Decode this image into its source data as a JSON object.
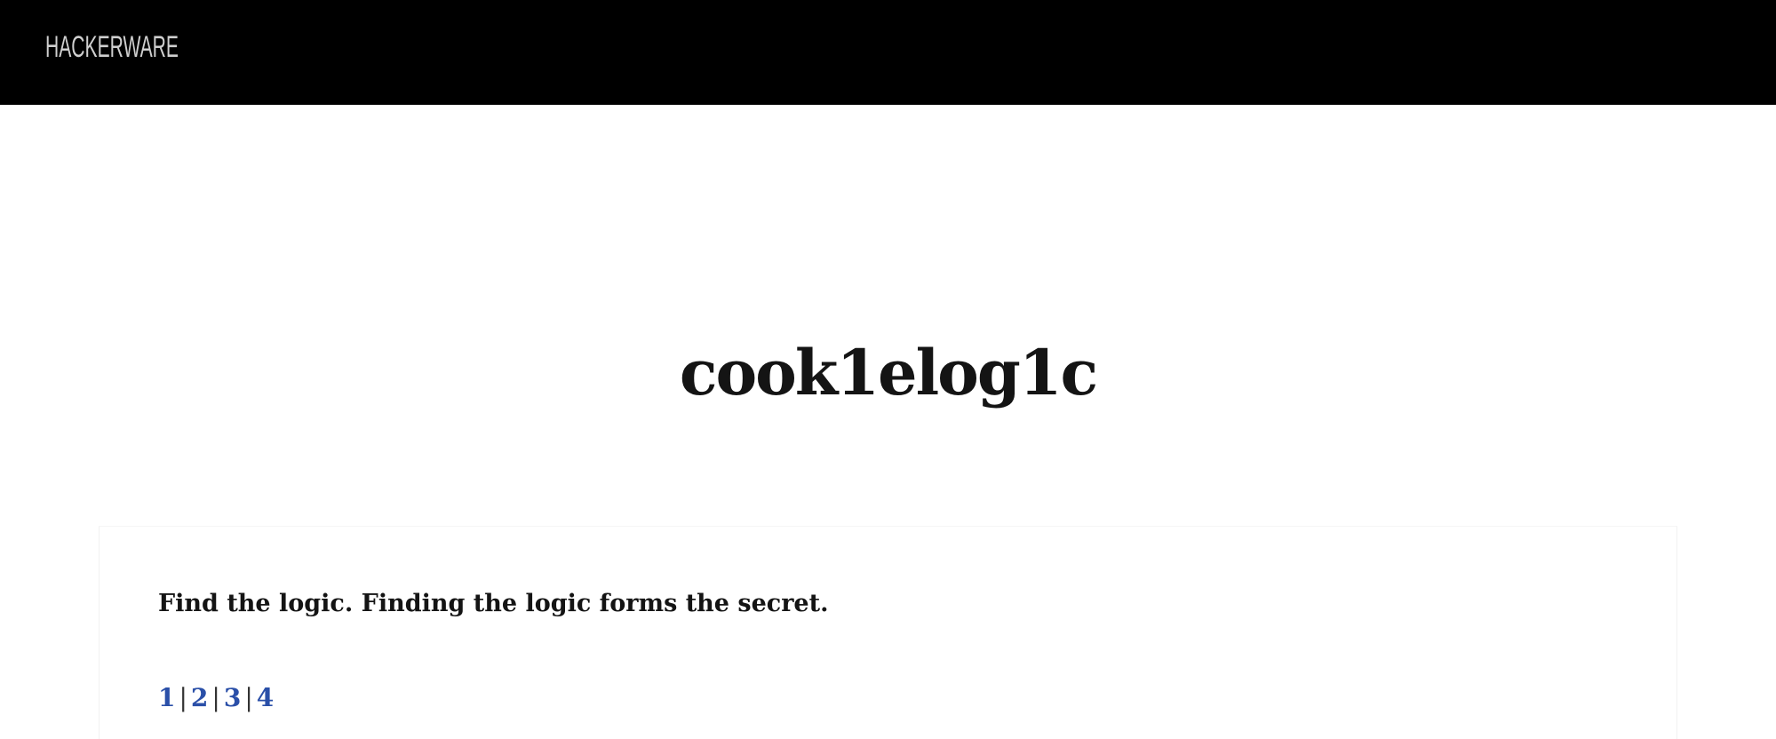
{
  "header": {
    "logo_text": "HACKERWARE",
    "background": "#000000"
  },
  "main": {
    "title": "cook1elog1c",
    "intro": "Find the logic. Finding the logic forms the secret.",
    "pages": [
      {
        "label": "1"
      },
      {
        "label": "2"
      },
      {
        "label": "3"
      },
      {
        "label": "4"
      }
    ],
    "separator": "|",
    "link_color": "#2a4fa8"
  }
}
